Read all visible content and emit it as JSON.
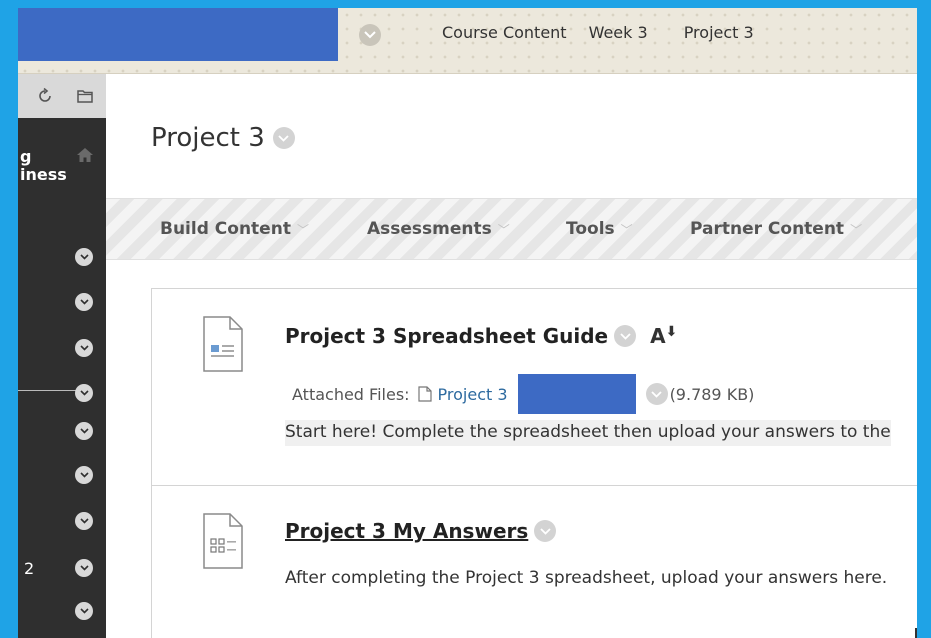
{
  "breadcrumbs": [
    {
      "label": "Course Content"
    },
    {
      "label": "Week 3"
    },
    {
      "label": "Project 3"
    }
  ],
  "sidebar": {
    "course_title_line1": "g",
    "course_title_line2": "iness",
    "partial_number": "2"
  },
  "page": {
    "title": "Project 3"
  },
  "action_bar": {
    "items": [
      {
        "label": "Build Content"
      },
      {
        "label": "Assessments"
      },
      {
        "label": "Tools"
      },
      {
        "label": "Partner Content"
      }
    ]
  },
  "content_items": [
    {
      "title": "Project 3 Spreadsheet Guide",
      "attached_label": "Attached Files:",
      "file_name": "Project 3",
      "file_size": "(9.789 KB)",
      "description": "Start here! Complete the spreadsheet then upload your answers to the"
    },
    {
      "title": "Project 3 My Answers",
      "description": "After completing the Project 3 spreadsheet, upload your answers here."
    }
  ],
  "colors": {
    "frame_border": "#1fa3e6",
    "redaction": "#3d6ac4",
    "sidebar_bg": "#2f2f2f",
    "link": "#2d6a9f"
  }
}
